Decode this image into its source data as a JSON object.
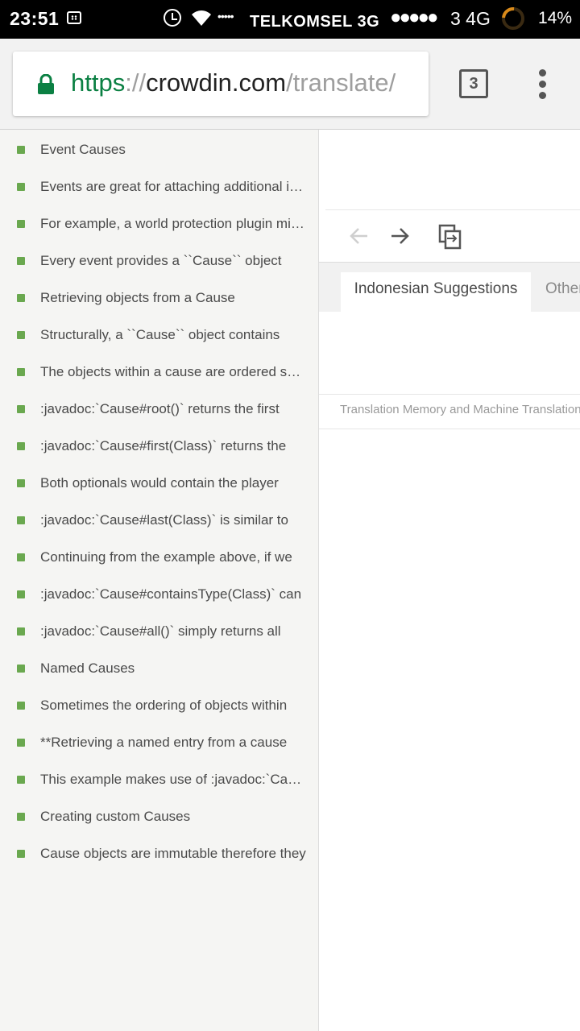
{
  "status_bar": {
    "time": "23:51",
    "carrier": "TELKOMSEL 3G",
    "signal_dots": "●●●●●",
    "small_dots": "•••••",
    "network": "3 4G",
    "battery": "14%",
    "icons": [
      "bbm-icon",
      "alarm-icon",
      "wifi-icon",
      "battery-icon"
    ]
  },
  "browser": {
    "url_scheme": "https",
    "url_sep": "://",
    "url_host": "crowdin.com",
    "url_path": "/translate/",
    "tab_count": "3",
    "secure_color": "#0b8043"
  },
  "list": {
    "bullet_color": "#6aa84f",
    "items": [
      "Event Causes",
      "Events are great for attaching additional information",
      "For example, a world protection plugin might",
      "Every event provides a ``Cause`` object",
      "Retrieving objects from a Cause",
      "Structurally, a ``Cause`` object contains",
      "The objects within a cause are ordered such",
      ":javadoc:`Cause#root()` returns the first",
      ":javadoc:`Cause#first(Class)` returns the",
      "Both optionals would contain the player",
      ":javadoc:`Cause#last(Class)` is similar to",
      "Continuing from the example above, if we",
      ":javadoc:`Cause#containsType(Class)` can",
      ":javadoc:`Cause#all()` simply returns all",
      "Named Causes",
      "Sometimes the ordering of objects within",
      "**Retrieving a named entry from a cause",
      "This example makes use of :javadoc:`Cause",
      "Creating custom Causes",
      "Cause objects are immutable therefore they"
    ]
  },
  "editor": {
    "tab_active": "Indonesian Suggestions",
    "tab_other": "Other Languages",
    "tm_label": "Translation Memory and Machine Translation"
  }
}
